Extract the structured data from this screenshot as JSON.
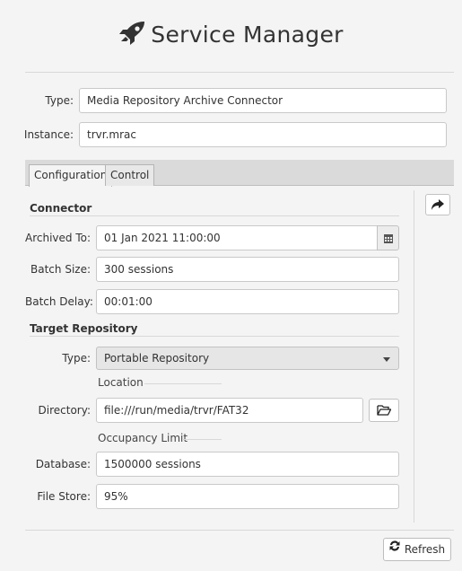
{
  "header": {
    "title": "Service Manager",
    "logo_icon": "rocket-icon"
  },
  "service": {
    "type_label": "Type:",
    "type_value": "Media Repository Archive Connector",
    "instance_label": "Instance:",
    "instance_value": "trvr.mrac"
  },
  "tabs": [
    {
      "label": "Configuration",
      "active": true
    },
    {
      "label": "Control",
      "active": false
    }
  ],
  "connector": {
    "section_title": "Connector",
    "archived_to_label": "Archived To:",
    "archived_to_value": "01 Jan 2021 11:00:00",
    "batch_size_label": "Batch Size:",
    "batch_size_value": "300 sessions",
    "batch_delay_label": "Batch Delay:",
    "batch_delay_value": "00:01:00"
  },
  "target": {
    "section_title": "Target Repository",
    "type_label": "Type:",
    "type_value": "Portable Repository",
    "location_title": "Location",
    "directory_label": "Directory:",
    "directory_value": "file:///run/media/trvr/FAT32",
    "occupancy_title": "Occupancy Limit",
    "database_label": "Database:",
    "database_value": "1500000 sessions",
    "file_store_label": "File Store:",
    "file_store_value": "95%"
  },
  "actions": {
    "refresh_label": "Refresh",
    "apply_icon": "share-arrow-icon"
  }
}
